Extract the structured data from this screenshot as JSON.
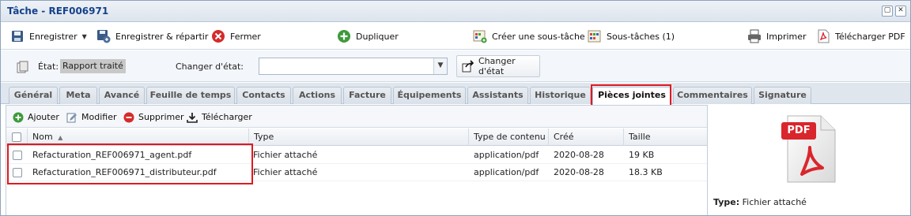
{
  "window": {
    "title": "Tâche - REF006971"
  },
  "toolbar": {
    "save": "Enregistrer",
    "save_dispatch": "Enregistrer & répartir",
    "close": "Fermer",
    "duplicate": "Dupliquer",
    "create_subtask": "Créer une sous-tâche",
    "subtasks": "Sous-tâches (1)",
    "print": "Imprimer",
    "download_pdf": "Télécharger PDF"
  },
  "state": {
    "label": "État:",
    "value": "Rapport traité",
    "change_label": "Changer d'état:",
    "change_select_value": "",
    "change_button": "Changer d'état"
  },
  "tabs": [
    {
      "label": "Général"
    },
    {
      "label": "Meta"
    },
    {
      "label": "Avancé"
    },
    {
      "label": "Feuille de temps"
    },
    {
      "label": "Contacts"
    },
    {
      "label": "Actions"
    },
    {
      "label": "Facture"
    },
    {
      "label": "Équipements"
    },
    {
      "label": "Assistants"
    },
    {
      "label": "Historique"
    },
    {
      "label": "Pièces jointes",
      "active": true
    },
    {
      "label": "Commentaires"
    },
    {
      "label": "Signature"
    }
  ],
  "attachments_toolbar": {
    "add": "Ajouter",
    "edit": "Modifier",
    "delete": "Supprimer",
    "download": "Télécharger"
  },
  "grid": {
    "columns": [
      "Nom",
      "Type",
      "Type de contenu",
      "Créé",
      "Taille"
    ],
    "sort_column": "Nom",
    "rows": [
      {
        "name": "Refacturation_REF006971_agent.pdf",
        "type": "Fichier attaché",
        "content_type": "application/pdf",
        "created": "2020-08-28",
        "size": "19 KB"
      },
      {
        "name": "Refacturation_REF006971_distributeur.pdf",
        "type": "Fichier attaché",
        "content_type": "application/pdf",
        "created": "2020-08-28",
        "size": "18.3 KB"
      }
    ]
  },
  "preview": {
    "file_icon_label": "PDF",
    "type_label": "Type:",
    "type_value": "Fichier attaché"
  },
  "colors": {
    "title_text": "#15428b",
    "highlight_box": "#e0191f",
    "pdf_red": "#d9262c"
  },
  "icons": [
    "save-icon",
    "save-dispatch-icon",
    "close-icon",
    "duplicate-icon",
    "create-subtask-icon",
    "subtasks-icon",
    "print-icon",
    "pdf-download-icon",
    "state-icon",
    "change-state-icon",
    "add-icon",
    "edit-icon",
    "delete-icon",
    "download-icon",
    "pdf-file-icon"
  ]
}
